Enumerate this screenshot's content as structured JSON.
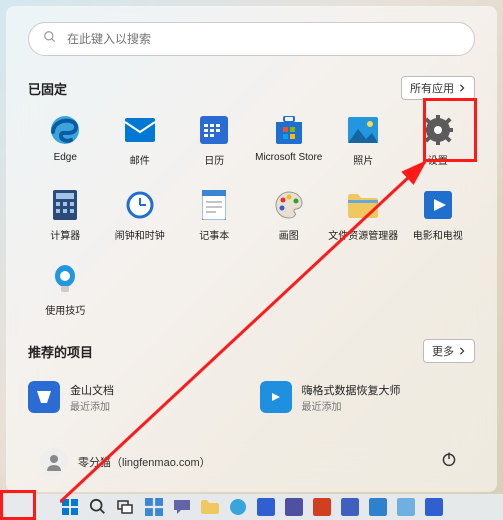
{
  "search": {
    "placeholder": "在此键入以搜索"
  },
  "pinned": {
    "title": "已固定",
    "all_apps_label": "所有应用",
    "apps": [
      {
        "label": "Edge"
      },
      {
        "label": "邮件"
      },
      {
        "label": "日历"
      },
      {
        "label": "Microsoft Store"
      },
      {
        "label": "照片"
      },
      {
        "label": "设置"
      },
      {
        "label": "计算器"
      },
      {
        "label": "闹钟和时钟"
      },
      {
        "label": "记事本"
      },
      {
        "label": "画图"
      },
      {
        "label": "文件资源管理器"
      },
      {
        "label": "电影和电视"
      },
      {
        "label": "使用技巧"
      }
    ]
  },
  "recommended": {
    "title": "推荐的项目",
    "more_label": "更多",
    "items": [
      {
        "title": "金山文档",
        "sub": "最近添加"
      },
      {
        "title": "嗨格式数据恢复大师",
        "sub": "最近添加"
      }
    ]
  },
  "user": {
    "name": "零分猫（lingfenmao.com）"
  },
  "colors": {
    "edge": "#0c59a4",
    "mail": "#0078d4",
    "calendar": "#2b6cd4",
    "store": "#1f6fd0",
    "photos": "#2297e0",
    "settings": "#5b5b5b",
    "calc": "#2b4a7a",
    "clock": "#1f6fd0",
    "notepad": "#3b87d4",
    "paint": "#e0e0e0",
    "explorer": "#f0c860",
    "movies": "#1f6fd0",
    "tips": "#2297e0",
    "wps": "#2b6cd4",
    "hgs": "#1f8fe0"
  }
}
